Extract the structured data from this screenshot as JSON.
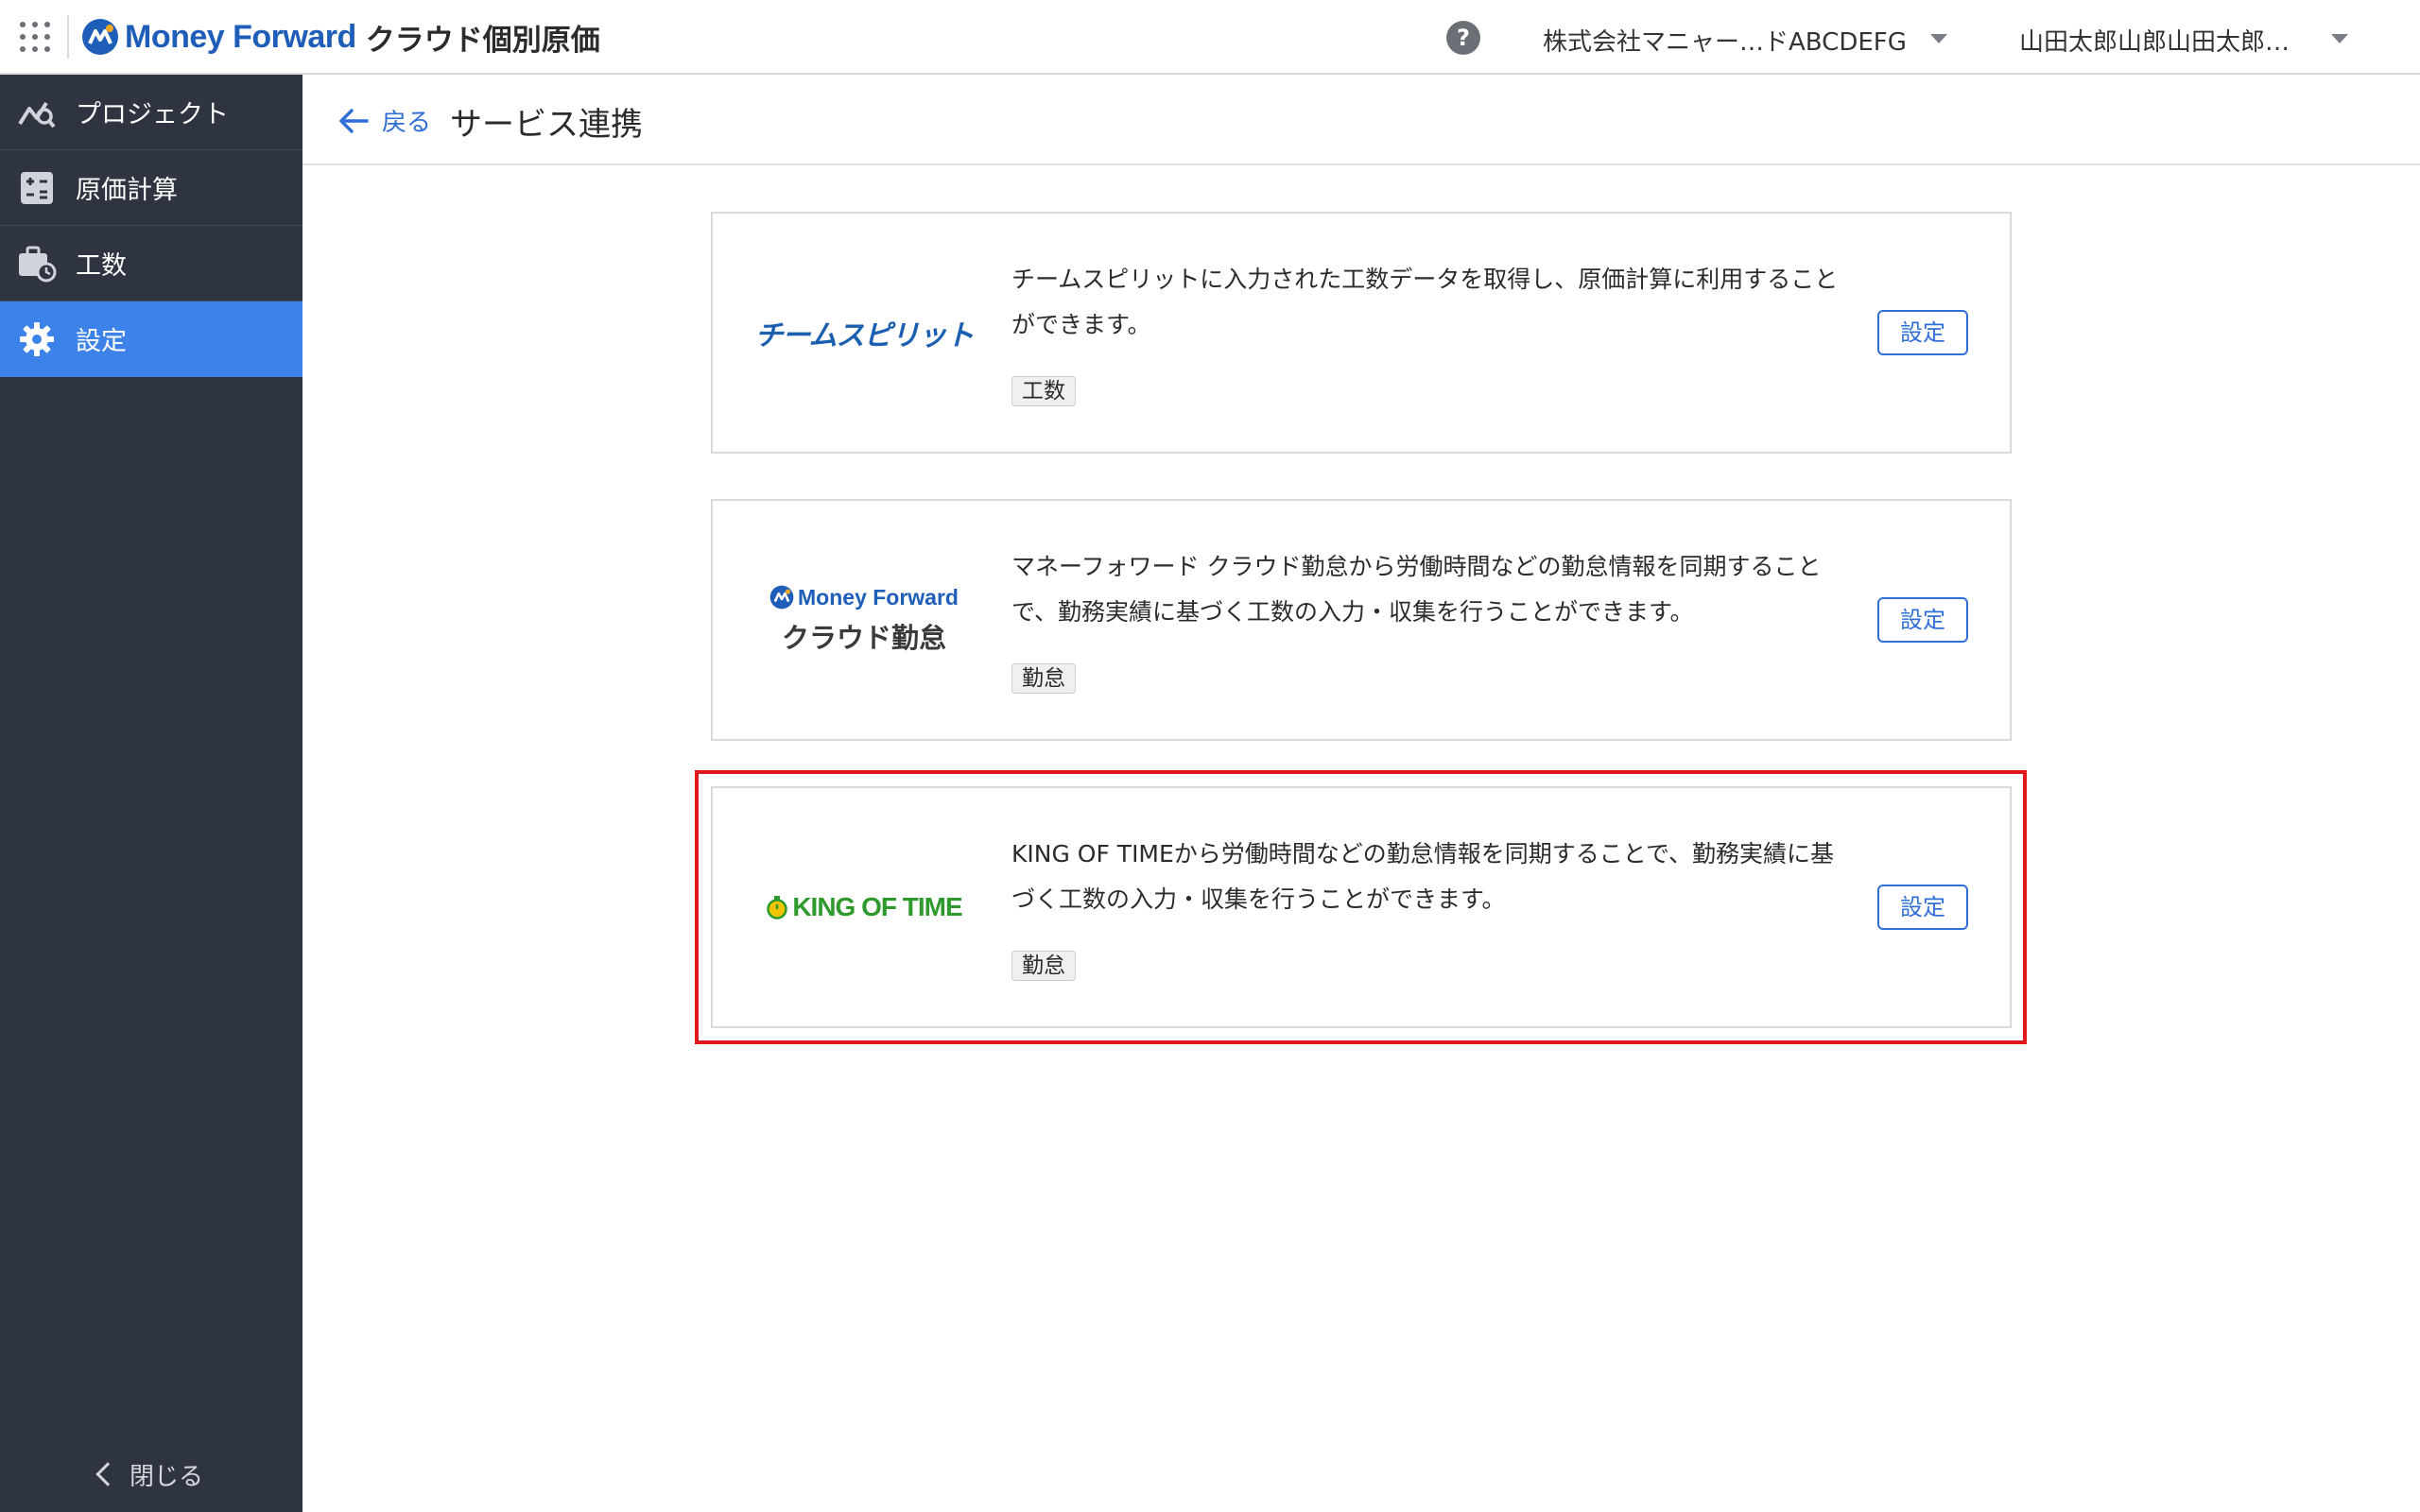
{
  "header": {
    "brand": "Money Forward",
    "product": "クラウド個別原価",
    "help_label": "?",
    "company": "株式会社マニャー…ドABCDEFG",
    "user": "山田太郎山郎山田太郎…"
  },
  "sidebar": {
    "items": [
      {
        "label": "プロジェクト",
        "icon": "project-chart-icon"
      },
      {
        "label": "原価計算",
        "icon": "calculator-icon"
      },
      {
        "label": "工数",
        "icon": "briefcase-clock-icon"
      },
      {
        "label": "設定",
        "icon": "gear-icon",
        "active": true
      }
    ],
    "close_label": "閉じる"
  },
  "page": {
    "back_label": "戻る",
    "title": "サービス連携"
  },
  "services": [
    {
      "logo_text": "チームスピリット",
      "description": "チームスピリットに入力された工数データを取得し、原価計算に利用することができます。",
      "tag": "工数",
      "button": "設定"
    },
    {
      "logo_text_top": "Money Forward",
      "logo_text_bottom": "クラウド勤怠",
      "description": "マネーフォワード クラウド勤怠から労働時間などの勤怠情報を同期することで、勤務実績に基づく工数の入力・収集を行うことができます。",
      "tag": "勤怠",
      "button": "設定"
    },
    {
      "logo_text": "KING OF TIME",
      "description": "KING OF TIMEから労働時間などの勤怠情報を同期することで、勤務実績に基づく工数の入力・収集を行うことができます。",
      "tag": "勤怠",
      "button": "設定",
      "highlighted": true
    }
  ],
  "colors": {
    "accent": "#2f6fd6",
    "sidebar_bg": "#2f3540",
    "active_nav": "#3d82e8",
    "highlight": "#e2191c"
  }
}
